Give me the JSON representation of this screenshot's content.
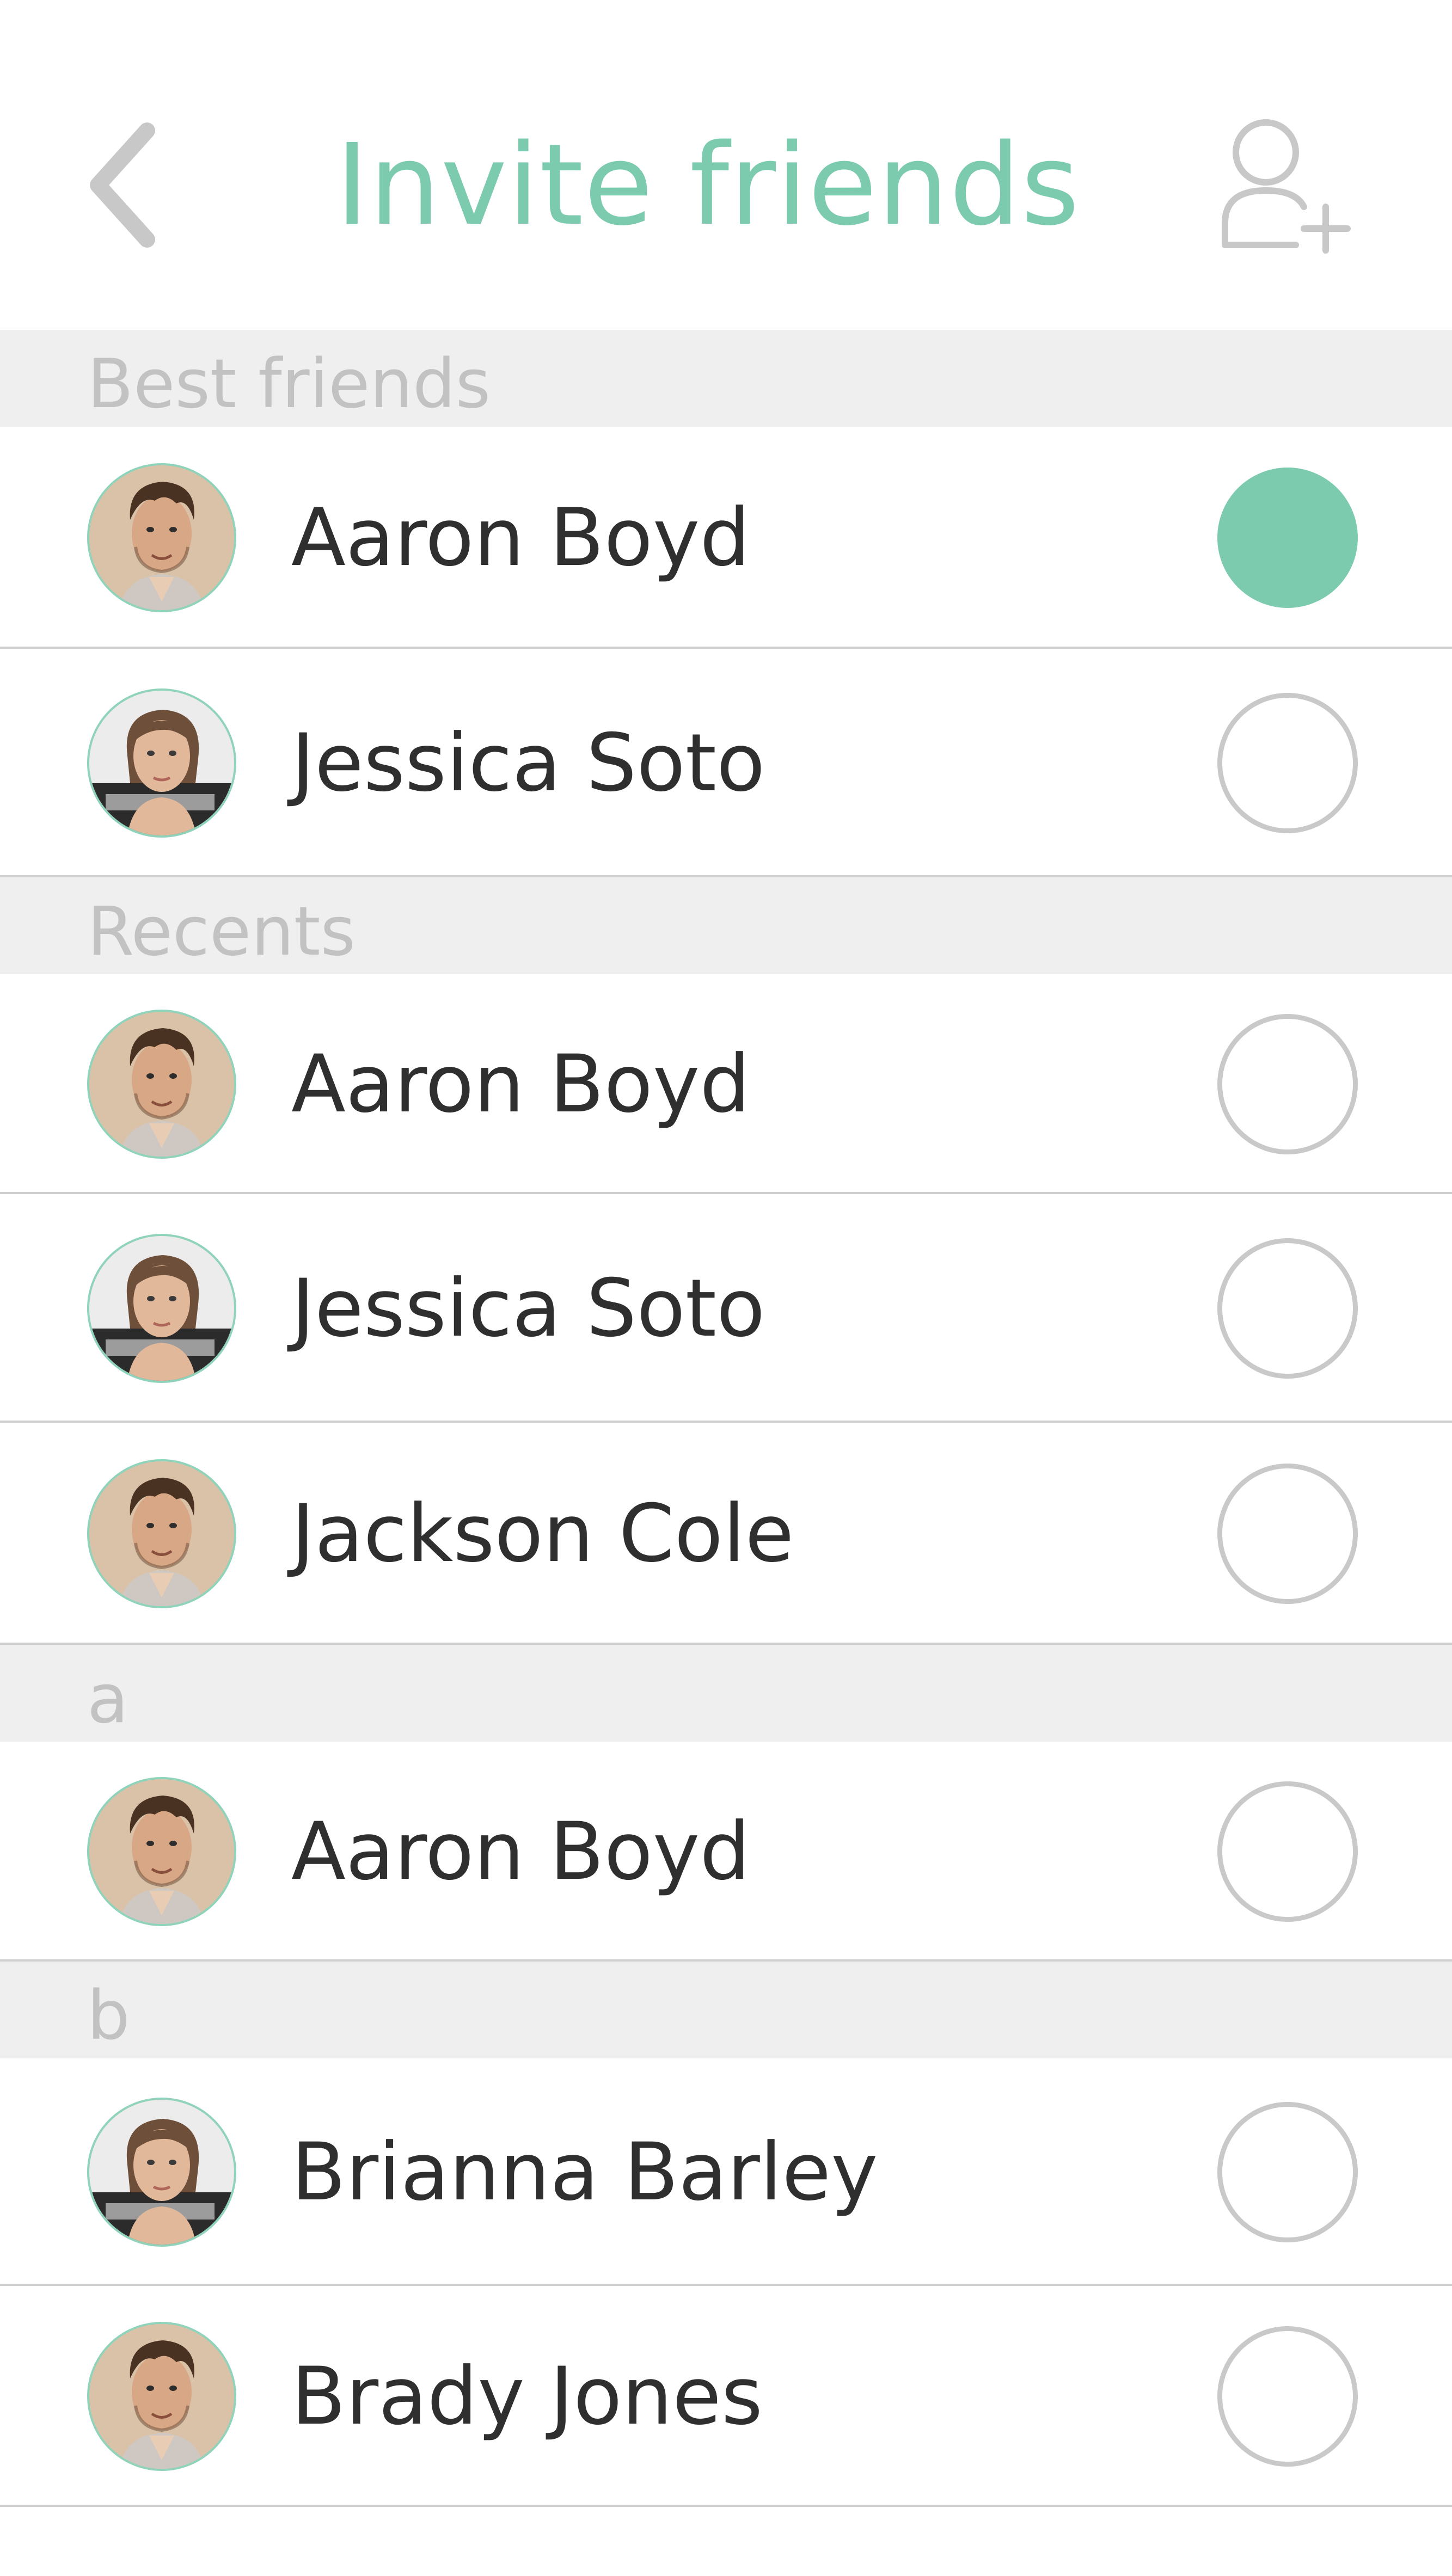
{
  "header": {
    "title": "Invite friends",
    "back_icon": "chevron-left-icon",
    "add_icon": "add-user-icon",
    "accent": "#7ccbaf"
  },
  "sections": [
    {
      "label": "Best friends",
      "rows": [
        {
          "name": "Aaron Boyd",
          "avatar": "man",
          "selected": true
        },
        {
          "name": "Jessica Soto",
          "avatar": "woman",
          "selected": false
        }
      ]
    },
    {
      "label": "Recents",
      "rows": [
        {
          "name": "Aaron Boyd",
          "avatar": "man",
          "selected": false
        },
        {
          "name": "Jessica Soto",
          "avatar": "woman",
          "selected": false
        },
        {
          "name": "Jackson Cole",
          "avatar": "man",
          "selected": false
        }
      ]
    },
    {
      "label": "a",
      "rows": [
        {
          "name": "Aaron Boyd",
          "avatar": "man",
          "selected": false
        }
      ]
    },
    {
      "label": "b",
      "rows": [
        {
          "name": "Brianna Barley",
          "avatar": "woman",
          "selected": false
        },
        {
          "name": "Brady Jones",
          "avatar": "man",
          "selected": false
        }
      ]
    }
  ]
}
